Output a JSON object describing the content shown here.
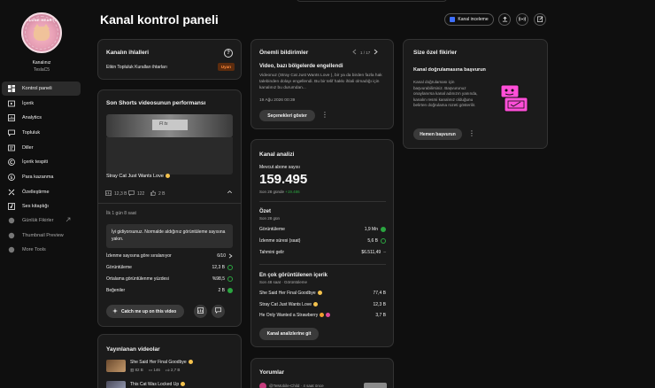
{
  "header": {
    "title": "Kanal kontrol paneli",
    "channel_review_label": "Kanal inceleme"
  },
  "sidebar": {
    "avatar_text": "OLUNE HEARTS",
    "channel_name": "Kanalınız",
    "channel_handle": "TeslaC5",
    "items": [
      {
        "label": "Kontrol paneli",
        "icon": "dashboard-icon"
      },
      {
        "label": "İçerik",
        "icon": "content-icon"
      },
      {
        "label": "Analytics",
        "icon": "analytics-icon"
      },
      {
        "label": "Topluluk",
        "icon": "community-icon"
      },
      {
        "label": "Diller",
        "icon": "languages-icon"
      },
      {
        "label": "İçerik tespiti",
        "icon": "copyright-icon"
      },
      {
        "label": "Para kazanma",
        "icon": "monetization-icon"
      },
      {
        "label": "Özelleştirme",
        "icon": "customization-icon"
      },
      {
        "label": "Ses kitaplığı",
        "icon": "audio-library-icon"
      },
      {
        "label": "Günlük Fikirler",
        "icon": "ideas-icon"
      },
      {
        "label": "Thumbnail Preview",
        "icon": "thumbnail-icon"
      },
      {
        "label": "More Tools",
        "icon": "tools-icon"
      }
    ]
  },
  "violations": {
    "title": "Kanalın ihlalleri",
    "item": "Etkin Topluluk Kuralları ihtarları",
    "badge": "Uyarı"
  },
  "shorts": {
    "title": "Son Shorts videosunun performansı",
    "video_title": "Stray Cat Just Wants Love",
    "views": "12,3 B",
    "comments": "122",
    "likes": "2 B",
    "age": "İlk 1 gün 8 saat",
    "message": "İyi gidiyorsunuz. Normalde aldığınız görüntüleme sayısına yakın.",
    "ranking_label": "İzlenme sayısına göre sıralanıyor",
    "ranking_value": "6/10",
    "stats": [
      {
        "label": "Görüntüleme",
        "value": "12,3 B",
        "icon": "check-outline-icon"
      },
      {
        "label": "Ortalama görüntülenme yüzdesi",
        "value": "%98,5",
        "icon": "check-outline-icon"
      },
      {
        "label": "Beğeniler",
        "value": "2 B",
        "icon": "arrow-up-circle-icon"
      }
    ],
    "catch_up_label": "Catch me up on this video"
  },
  "published": {
    "title": "Yayınlanan videolar",
    "videos": [
      {
        "title": "She Said Her Final Goodbye",
        "views": "82 B",
        "comments": "146",
        "likes": "2,7 B"
      },
      {
        "title": "This Cat Was Locked Up",
        "views": "",
        "comments": "",
        "likes": ""
      }
    ]
  },
  "notifications": {
    "title": "Önemli bildirimler",
    "pager": "1 / 17",
    "headline": "Video, bazı bölgelerde engellendi",
    "body": "Videonuz (Stray Cat Just Wants Love ), bir ya da birden fazla hak talebinden dolayı engellendi. Bu bir telif hakkı ihlali olmadığı için kanalınız bu durumdan...",
    "date": "19 Ağu 2026 00:39",
    "options_label": "Seçenekleri göster"
  },
  "analytics": {
    "title": "Kanal analizi",
    "subs_label": "Mevcut abone sayısı",
    "subs_value": "159.495",
    "subs_change_label": "Son 28 günde",
    "subs_change_value": "+19.486",
    "summary_title": "Özet",
    "summary_period": "Son 28 gün",
    "summary": [
      {
        "label": "Görüntüleme",
        "value": "1,9 Mn",
        "icon": "arrow-up-circle-icon"
      },
      {
        "label": "İzlenme süresi (saat)",
        "value": "5,6 B",
        "icon": "check-outline-icon"
      },
      {
        "label": "Tahmini gelir",
        "value": "$6.511,49",
        "icon": "dash-icon"
      }
    ],
    "top_title": "En çok görüntülenen içerik",
    "top_period": "Son 48 saat · Görüntüleme",
    "top": [
      {
        "label": "She Said Her Final Goodbye",
        "value": "77,4 B"
      },
      {
        "label": "Stray Cat Just Wants Love",
        "value": "12,3 B"
      },
      {
        "label": "He Only Wanted a Strawberry",
        "value": "3,7 B"
      }
    ],
    "button_label": "Kanal analizlerine git"
  },
  "comments": {
    "title": "Yorumlar",
    "first_author": "@TeMobile-Child · 4 saat önce"
  },
  "ideas": {
    "title": "Size özel fikirler",
    "heading": "Kanal doğrulamasına başvurun",
    "body": "Kanal doğrulaması için başvurabilirsiniz. Başvurunuz onaylanırsa kanal adınızın yanında, kanalın resmi kanalınız olduğunu belirten doğrulama rozeti gösterilir.",
    "button_label": "Hemen başvurun"
  },
  "colors": {
    "accent_blue": "#3ea6ff",
    "green": "#2ba640",
    "badge_bg": "#5c2c0e",
    "badge_text": "#ff8a3c",
    "illustration": "#ff4ed8"
  }
}
